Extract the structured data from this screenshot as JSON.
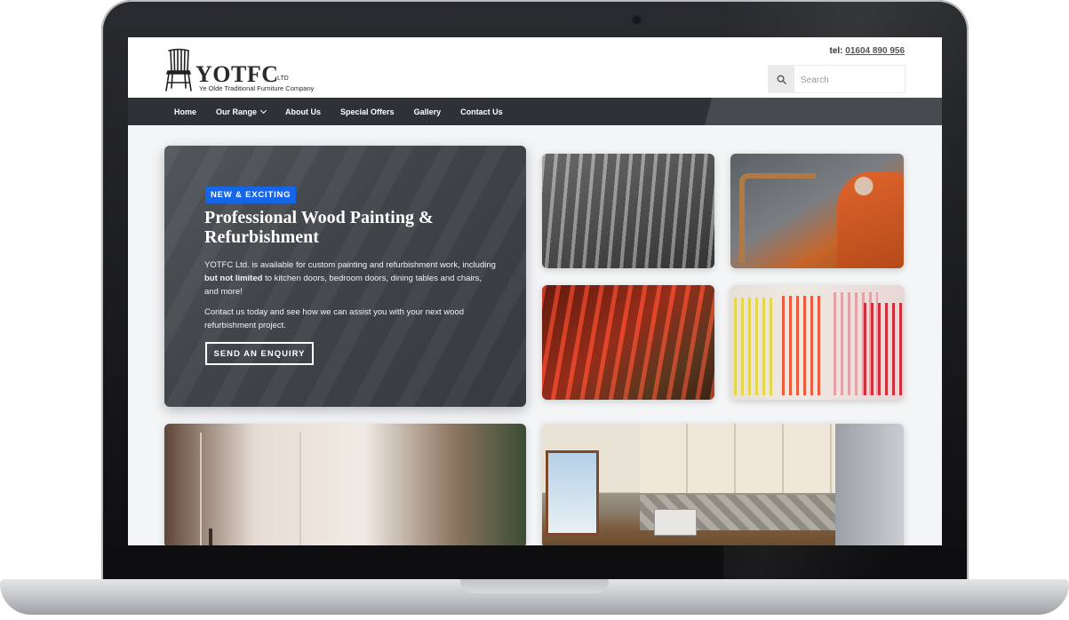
{
  "brand": {
    "name": "YOTFC",
    "suffix": "LTD",
    "tagline": "Ye Olde Traditional Furniture Company"
  },
  "header": {
    "tel_label": "tel:",
    "tel_number": "01604 890 956",
    "search_placeholder": "Search"
  },
  "nav": {
    "items": [
      "Home",
      "Our Range",
      "About Us",
      "Special Offers",
      "Gallery",
      "Contact Us"
    ]
  },
  "hero": {
    "badge": "NEW & EXCITING",
    "title": "Professional Wood Painting & Refurbishment",
    "text1_a": "YOTFC Ltd. is available for custom painting and refurbishment work, including ",
    "text1_bold": "but not limited",
    "text1_b": " to kitchen doors, bedroom doors, dining tables and chairs, and more!",
    "text2": "Contact us today and see how we can assist you with your next wood refurbishment project.",
    "cta": "SEND AN ENQUIRY"
  },
  "colors": {
    "nav_bg": "#2e3236",
    "badge_bg": "#1565e8",
    "hero_bg": "#43474b",
    "content_bg": "#f4f5f6"
  },
  "icons": {
    "logo": "chair-icon",
    "search": "search-icon",
    "dropdown": "chevron-down-icon",
    "camera": "camera-icon"
  }
}
